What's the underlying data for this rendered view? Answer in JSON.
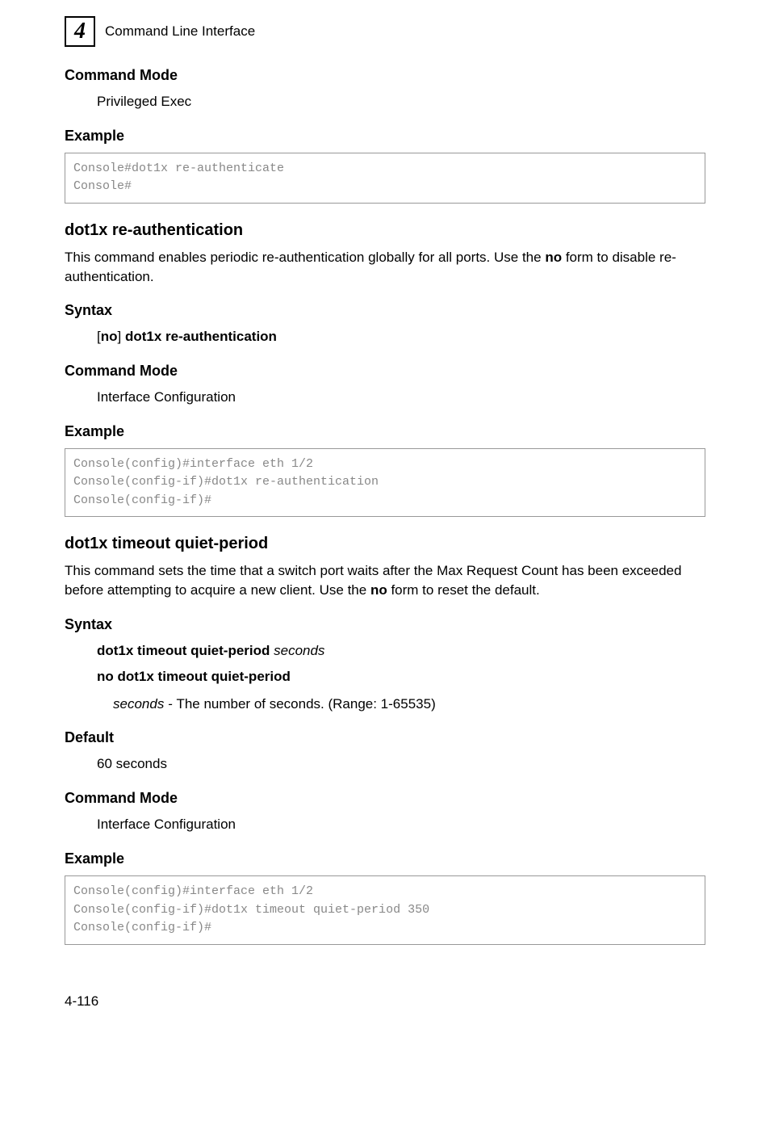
{
  "header": {
    "chapter": "4",
    "title": "Command Line Interface"
  },
  "sections": {
    "cmd_mode_1": {
      "heading": "Command Mode",
      "text": "Privileged Exec"
    },
    "example_1": {
      "heading": "Example",
      "code": "Console#dot1x re-authenticate\nConsole#"
    },
    "reauth": {
      "heading": "dot1x re-authentication",
      "desc_part1": "This command enables periodic re-authentication globally for all ports. Use the ",
      "desc_bold": "no",
      "desc_part2": " form to disable re-authentication."
    },
    "syntax_1": {
      "heading": "Syntax",
      "prefix": "[",
      "no": "no",
      "mid": "] ",
      "cmd": "dot1x re-authentication"
    },
    "cmd_mode_2": {
      "heading": "Command Mode",
      "text": "Interface Configuration"
    },
    "example_2": {
      "heading": "Example",
      "code": "Console(config)#interface eth 1/2\nConsole(config-if)#dot1x re-authentication\nConsole(config-if)#"
    },
    "quiet": {
      "heading": "dot1x timeout quiet-period",
      "desc_part1": "This command sets the time that a switch port waits after the Max Request Count has been exceeded before attempting to acquire a new client. Use the ",
      "desc_bold": "no",
      "desc_part2": " form to reset the default."
    },
    "syntax_2": {
      "heading": "Syntax",
      "line1_bold": "dot1x timeout quiet-period ",
      "line1_italic": "seconds",
      "line2": "no dot1x timeout quiet-period",
      "param_italic": "seconds - ",
      "param_text": "The number of seconds. (Range: 1-65535)"
    },
    "default": {
      "heading": "Default",
      "text": "60 seconds"
    },
    "cmd_mode_3": {
      "heading": "Command Mode",
      "text": "Interface Configuration"
    },
    "example_3": {
      "heading": "Example",
      "code": "Console(config)#interface eth 1/2\nConsole(config-if)#dot1x timeout quiet-period 350\nConsole(config-if)#"
    }
  },
  "page_number": "4-116"
}
